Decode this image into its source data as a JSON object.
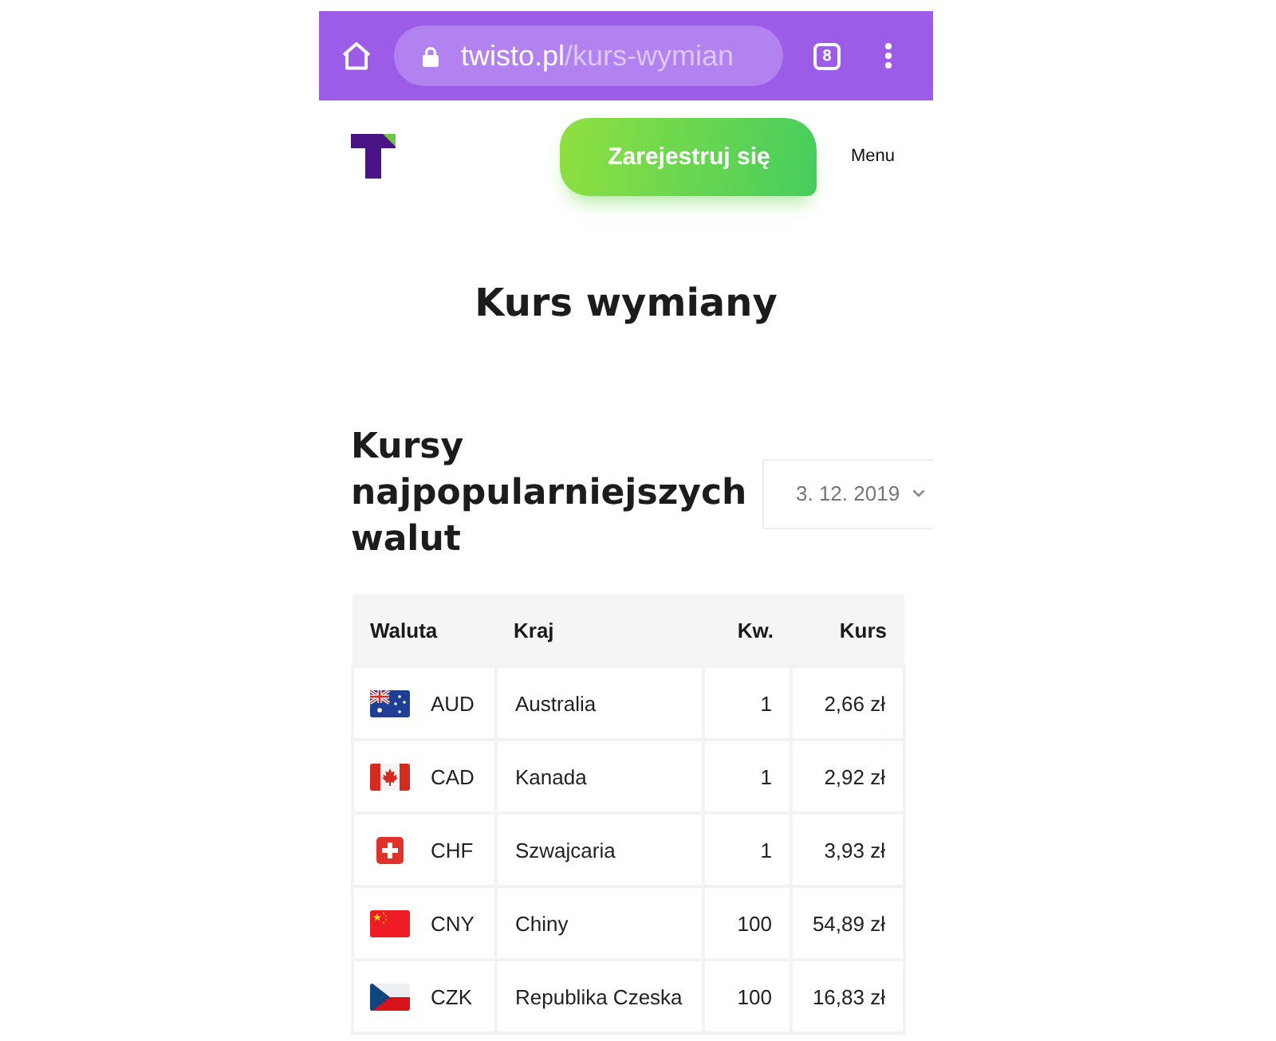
{
  "browser": {
    "url_host": "twisto.pl",
    "url_path": "/kurs-wymian",
    "tab_count": "8"
  },
  "header": {
    "signup_button": "Zarejestruj się",
    "menu_label": "Menu"
  },
  "title": "Kurs wymiany",
  "rates": {
    "heading": "Kursy najpopularniejszych walut",
    "date": "3. 12. 2019"
  },
  "table": {
    "columns": [
      "Waluta",
      "Kraj",
      "Kw.",
      "Kurs"
    ],
    "rows": [
      {
        "kind": "au",
        "code": "AUD",
        "country": "Australia",
        "amount": "1",
        "rate": "2,66 zł"
      },
      {
        "kind": "ca",
        "code": "CAD",
        "country": "Kanada",
        "amount": "1",
        "rate": "2,92 zł"
      },
      {
        "kind": "ch",
        "code": "CHF",
        "country": "Szwajcaria",
        "amount": "1",
        "rate": "3,93 zł"
      },
      {
        "kind": "cn",
        "code": "CNY",
        "country": "Chiny",
        "amount": "100",
        "rate": "54,89 zł"
      },
      {
        "kind": "cz",
        "code": "CZK",
        "country": "Republika Czeska",
        "amount": "100",
        "rate": "16,83 zł"
      }
    ]
  }
}
